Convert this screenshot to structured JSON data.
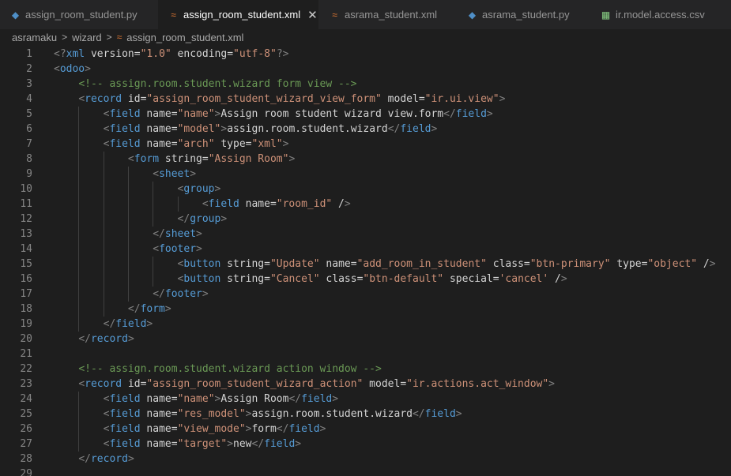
{
  "tabs": [
    {
      "label": "assign_room_student.py",
      "icon": "python-file-icon",
      "active": false
    },
    {
      "label": "assign_room_student.xml",
      "icon": "xml-file-icon",
      "active": true
    },
    {
      "label": "asrama_student.xml",
      "icon": "xml-file-icon",
      "active": false
    },
    {
      "label": "asrama_student.py",
      "icon": "python-file-icon",
      "active": false
    },
    {
      "label": "ir.model.access.csv",
      "icon": "csv-file-icon",
      "active": false
    }
  ],
  "breadcrumb": [
    "asramaku",
    "wizard",
    "assign_room_student.xml"
  ],
  "lines": [
    "<?xml version=\"1.0\" encoding=\"utf-8\"?>",
    "<odoo>",
    "    <!-- assign.room.student.wizard form view -->",
    "    <record id=\"assign_room_student_wizard_view_form\" model=\"ir.ui.view\">",
    "        <field name=\"name\">Assign room student wizard view.form</field>",
    "        <field name=\"model\">assign.room.student.wizard</field>",
    "        <field name=\"arch\" type=\"xml\">",
    "            <form string=\"Assign Room\">",
    "                <sheet>",
    "                    <group>",
    "                        <field name=\"room_id\" />",
    "                    </group>",
    "                </sheet>",
    "                <footer>",
    "                    <button string=\"Update\" name=\"add_room_in_student\" class=\"btn-primary\" type=\"object\" />",
    "                    <button string=\"Cancel\" class=\"btn-default\" special='cancel' />",
    "                </footer>",
    "            </form>",
    "        </field>",
    "    </record>",
    "",
    "    <!-- assign.room.student.wizard action window -->",
    "    <record id=\"assign_room_student_wizard_action\" model=\"ir.actions.act_window\">",
    "        <field name=\"name\">Assign Room</field>",
    "        <field name=\"res_model\">assign.room.student.wizard</field>",
    "        <field name=\"view_mode\">form</field>",
    "        <field name=\"target\">new</field>",
    "    </record>",
    ""
  ],
  "colors": {
    "tag": "#569cd6",
    "attribute": "#9cdcfe",
    "string": "#ce9178",
    "comment": "#6a9955",
    "bracket": "#808080",
    "text": "#d4d4d4"
  }
}
